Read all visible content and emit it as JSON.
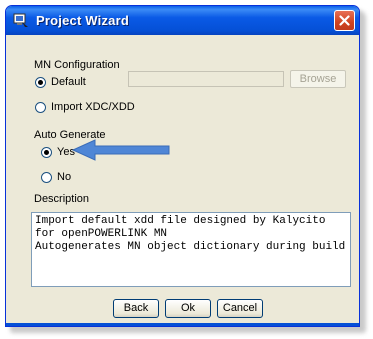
{
  "window": {
    "title": "Project Wizard"
  },
  "mn_config": {
    "section_label": "MN Configuration",
    "option_default": "Default",
    "option_import": "Import XDC/XDD",
    "path_value": "",
    "browse_label": "Browse"
  },
  "auto_generate": {
    "section_label": "Auto Generate",
    "option_yes": "Yes",
    "option_no": "No"
  },
  "description": {
    "label": "Description",
    "text": "Import default xdd file designed by Kalycito for openPOWERLINK MN\nAutogenerates MN object dictionary during build"
  },
  "buttons": {
    "back": "Back",
    "ok": "Ok",
    "cancel": "Cancel"
  },
  "colors": {
    "arrow": "#4f86d6",
    "title_bar": "#0a5ae6"
  }
}
